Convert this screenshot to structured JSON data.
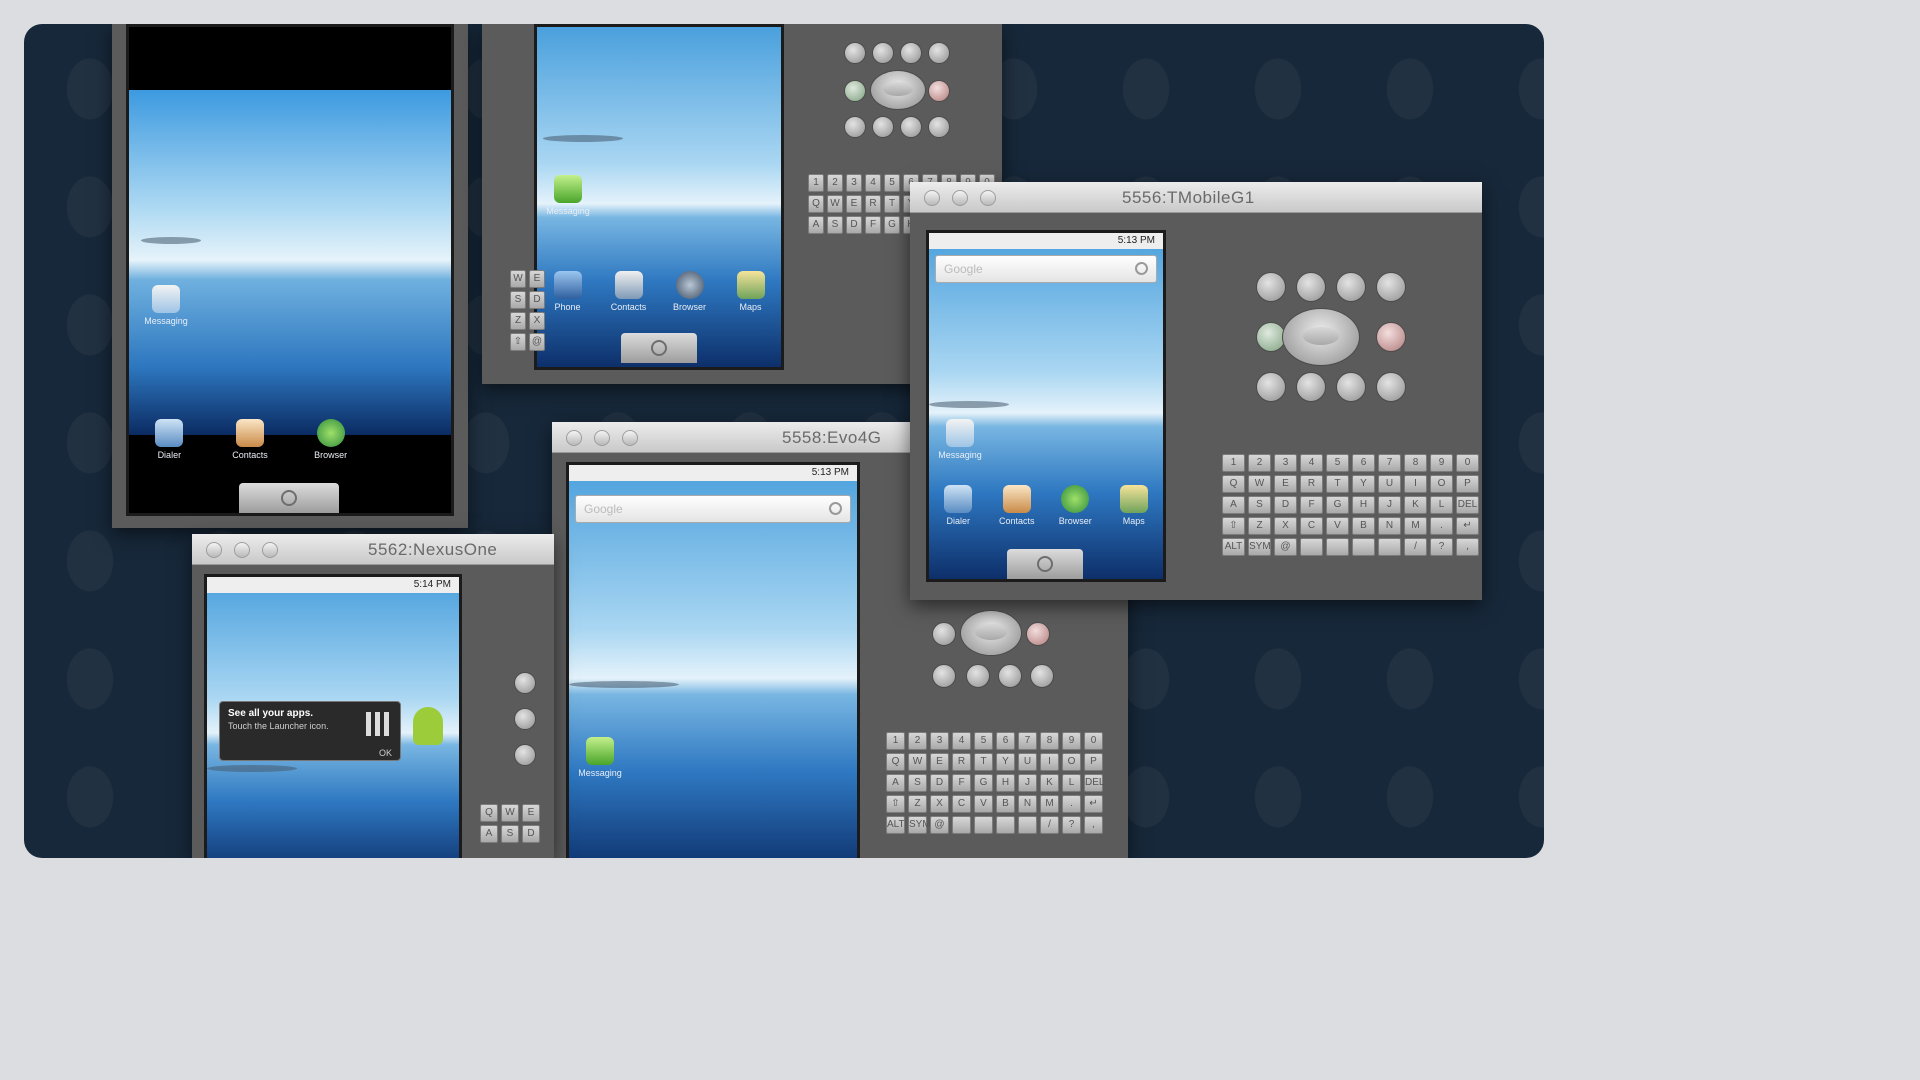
{
  "emulators": {
    "top_left": {
      "apps": [
        "Dialer",
        "Contacts",
        "Browser"
      ],
      "widget_label": "Messaging"
    },
    "top_center": {
      "widget_label": "Messaging",
      "apps": [
        "Phone",
        "Contacts",
        "Browser",
        "Maps"
      ]
    },
    "tmobile": {
      "title": "5556:TMobileG1",
      "status_time": "5:13 PM",
      "search_placeholder": "Google",
      "widget_label": "Messaging",
      "apps": [
        "Dialer",
        "Contacts",
        "Browser",
        "Maps"
      ]
    },
    "evo": {
      "title": "5558:Evo4G",
      "status_time": "5:13 PM",
      "search_placeholder": "Google",
      "widget_label": "Messaging"
    },
    "nexus": {
      "title": "5562:NexusOne",
      "status_time": "5:14 PM",
      "tip_title": "See all your apps.",
      "tip_text": "Touch the Launcher icon.",
      "tip_ok": "OK"
    }
  },
  "keyboard_rows": [
    [
      "1",
      "2",
      "3",
      "4",
      "5",
      "6",
      "7",
      "8",
      "9",
      "0"
    ],
    [
      "Q",
      "W",
      "E",
      "R",
      "T",
      "Y",
      "U",
      "I",
      "O",
      "P"
    ],
    [
      "A",
      "S",
      "D",
      "F",
      "G",
      "H",
      "J",
      "K",
      "L",
      "DEL"
    ],
    [
      "⇧",
      "Z",
      "X",
      "C",
      "V",
      "B",
      "N",
      "M",
      ".",
      "↵"
    ],
    [
      "ALT",
      "SYM",
      "@",
      "",
      "",
      "",
      "",
      "/",
      "?",
      ","
    ]
  ],
  "colors": {
    "desktop_bg": "#17283a",
    "emulator_body": "#5b5b5b",
    "sky": "#4aa0dd"
  }
}
